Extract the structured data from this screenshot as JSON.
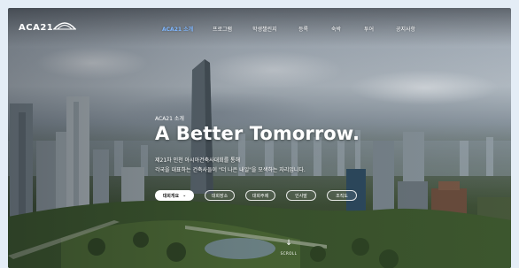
{
  "brand": {
    "logo_text": "ACA21",
    "logo_icon": "arch-bridge-icon"
  },
  "nav": {
    "items": [
      {
        "label": "ACA21 소개",
        "active": true
      },
      {
        "label": "프로그램",
        "active": false
      },
      {
        "label": "학생챌린지",
        "active": false
      },
      {
        "label": "등록",
        "active": false
      },
      {
        "label": "숙박",
        "active": false
      },
      {
        "label": "투어",
        "active": false
      },
      {
        "label": "공지사항",
        "active": false
      }
    ],
    "active_color": "#7fb7ff"
  },
  "hero": {
    "eyebrow": "ACA21 소개",
    "headline": "A Better Tomorrow.",
    "desc_line1": "제21차 인천 아시아건축사대회를 통해",
    "desc_line2": "각국을 대표하는 건축사들이 \"더 나은 내일\"을 모색하는 자리입니다.",
    "primary_button": {
      "label": "대회개요",
      "icon": "chevron-down-icon"
    },
    "ghost_buttons": [
      "대회장소",
      "대회주제",
      "인사말",
      "조직도"
    ]
  },
  "scroll": {
    "label": "SCROLL",
    "icon": "arrow-down-icon"
  }
}
